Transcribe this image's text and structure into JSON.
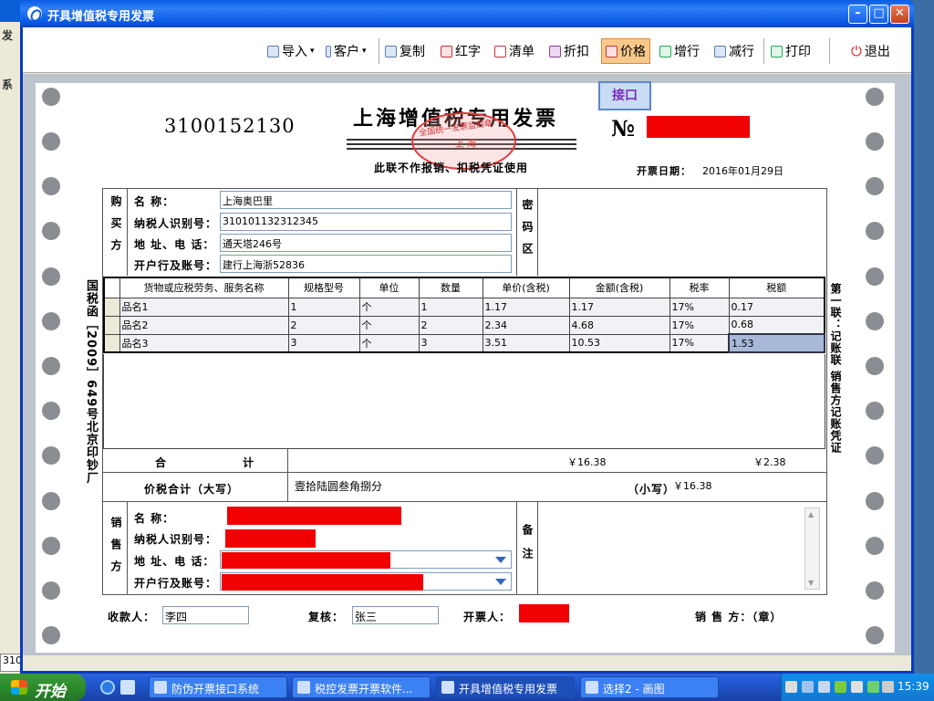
{
  "window": {
    "title": "开具增值税专用发票"
  },
  "toolbar": [
    {
      "label": "导入",
      "icon": "import-icon",
      "dropdown": true
    },
    {
      "label": "客户",
      "icon": "customer-icon",
      "dropdown": true
    },
    {
      "label": "复制",
      "icon": "copy-icon"
    },
    {
      "label": "红字",
      "icon": "red-invoice-icon"
    },
    {
      "label": "清单",
      "icon": "list-icon"
    },
    {
      "label": "折扣",
      "icon": "discount-icon"
    },
    {
      "label": "价格",
      "icon": "price-icon",
      "active": true
    },
    {
      "label": "增行",
      "icon": "add-row-icon"
    },
    {
      "label": "减行",
      "icon": "remove-row-icon"
    },
    {
      "label": "打印",
      "icon": "print-icon"
    },
    {
      "label": "退出",
      "icon": "power-icon"
    }
  ],
  "invoice": {
    "api_button": "接口",
    "code": "3100152130",
    "title": "上海增值税专用发票",
    "seal_line1": "全国统一发票监制章",
    "seal_line2": "上 海",
    "subtitle": "此联不作报销、扣税凭证使用",
    "no_label": "№",
    "date_label": "开票日期：",
    "date": "2016年01月29日",
    "left_vertical": "国税函［2009］649号北京印钞厂",
    "right_vertical": "第一联：记账联 销售方记账凭证",
    "buyer": {
      "section_label": "购买方",
      "name_label": "名 称：",
      "name": "上海奥巴里",
      "tax_id_label": "纳税人识别号：",
      "tax_id": "310101132312345",
      "address_label": "地 址、电 话：",
      "address": "通天塔246号",
      "bank_label": "开户行及账号：",
      "bank": "建行上海浙52836"
    },
    "password_label": "密码区",
    "items_headers": [
      "货物或应税劳务、服务名称",
      "规格型号",
      "单位",
      "数量",
      "单价(含税)",
      "金额(含税)",
      "税率",
      "税额"
    ],
    "items": [
      {
        "name": "品名1",
        "spec": "1",
        "unit": "个",
        "qty": "1",
        "price": "1.17",
        "amount": "1.17",
        "rate": "17%",
        "tax": "0.17"
      },
      {
        "name": "品名2",
        "spec": "2",
        "unit": "个",
        "qty": "2",
        "price": "2.34",
        "amount": "4.68",
        "rate": "17%",
        "tax": "0.68"
      },
      {
        "name": "品名3",
        "spec": "3",
        "unit": "个",
        "qty": "3",
        "price": "3.51",
        "amount": "10.53",
        "rate": "17%",
        "tax": "1.53"
      }
    ],
    "total_label": "合 计",
    "total_amount": "￥16.38",
    "total_tax": "￥2.38",
    "total_words_label": "价税合计（大写）",
    "total_words": "壹拾陆圆叁角捌分",
    "total_small_label": "（小写）",
    "total_small": "￥16.38",
    "seller": {
      "section_label": "销售方",
      "name_label": "名 称：",
      "tax_id_label": "纳税人识别号：",
      "address_label": "地 址、电 话：",
      "bank_label": "开户行及账号："
    },
    "remark_label": "备注",
    "payee_label": "收款人：",
    "payee": "李四",
    "reviewer_label": "复核：",
    "reviewer": "张三",
    "issuer_label": "开票人：",
    "seller_seal_label": "销 售 方：（章）"
  },
  "background": {
    "left_box": "310"
  },
  "taskbar": {
    "start": "开始",
    "tasks": [
      {
        "label": "防伪开票接口系统"
      },
      {
        "label": "税控发票开票软件..."
      },
      {
        "label": "开具增值税专用发票",
        "active": true
      },
      {
        "label": "选择2 - 画图"
      }
    ],
    "clock": "15:39"
  },
  "colors": {
    "redaction": "#f00000",
    "titlebar": "#0a5ae6",
    "active_tool": "#f8c98a"
  }
}
